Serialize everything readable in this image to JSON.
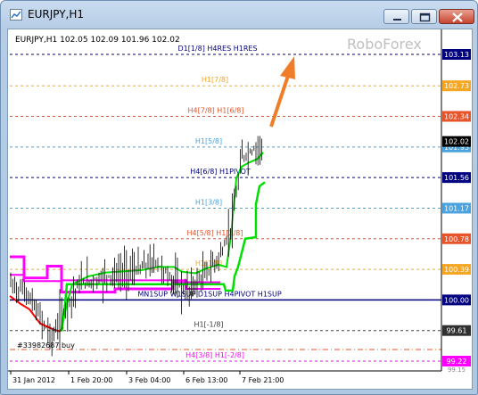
{
  "window": {
    "title": "EURJPY,H1"
  },
  "chart": {
    "header": "EURJPY,H1  102.05 102.09 101.96 102.02",
    "watermark": "RoboForex",
    "colors": {
      "magenta": "#ff00ff",
      "green": "#00e000",
      "red": "#ff0000",
      "orange": "#f07d28",
      "navy": "#000080"
    },
    "levels": [
      {
        "label": "D1[1/8] H4RES H1RES",
        "price": "103.13",
        "color": "#000080",
        "tag_bg": "#000080"
      },
      {
        "label": "H1[7/8]",
        "price": "102.73",
        "color": "#f5a623",
        "tag_bg": "#f5a623"
      },
      {
        "label": "H4[7/8] H1[6/8]",
        "price": "102.34",
        "color": "#e8542a",
        "tag_bg": "#e8542a"
      },
      {
        "label": "H1[5/8]",
        "price": "101.95",
        "color": "#4aa3df",
        "tag_bg": "#4aa3df"
      },
      {
        "label": "H4[6/8] H1PIVOT",
        "price": "101.56",
        "color": "#000080",
        "tag_bg": "#000080"
      },
      {
        "label": "H1[3/8]",
        "price": "101.17",
        "color": "#4aa3df",
        "tag_bg": "#4aa3df"
      },
      {
        "label": "H4[5/8] H1[2/8]",
        "price": "100.78",
        "color": "#e8542a",
        "tag_bg": "#e8542a"
      },
      {
        "label": "H1[1/8]",
        "price": "100.39",
        "color": "#f5a623",
        "tag_bg": "#f5a623"
      },
      {
        "label": "MN1SUP W1SUP D1SUP H4PIVOT H1SUP",
        "price": "100.00",
        "color": "#000080",
        "tag_bg": "#000080"
      },
      {
        "label": "H1[-1/8]",
        "price": "99.61",
        "color": "#404040",
        "tag_bg": "#303030"
      },
      {
        "label": "H4[3/8] H1[-2/8]",
        "price": "99.22",
        "color": "#ff00ff",
        "tag_bg": "#ff00ff"
      }
    ],
    "current_price": "102.02",
    "low_tick": "99.15",
    "order_label": "#33982687 buy",
    "order_price": "99.61",
    "x_labels": [
      "31 Jan 2012",
      "1 Feb 20:00",
      "3 Feb 04:00",
      "6 Feb 13:00",
      "7 Feb 21:00"
    ]
  }
}
